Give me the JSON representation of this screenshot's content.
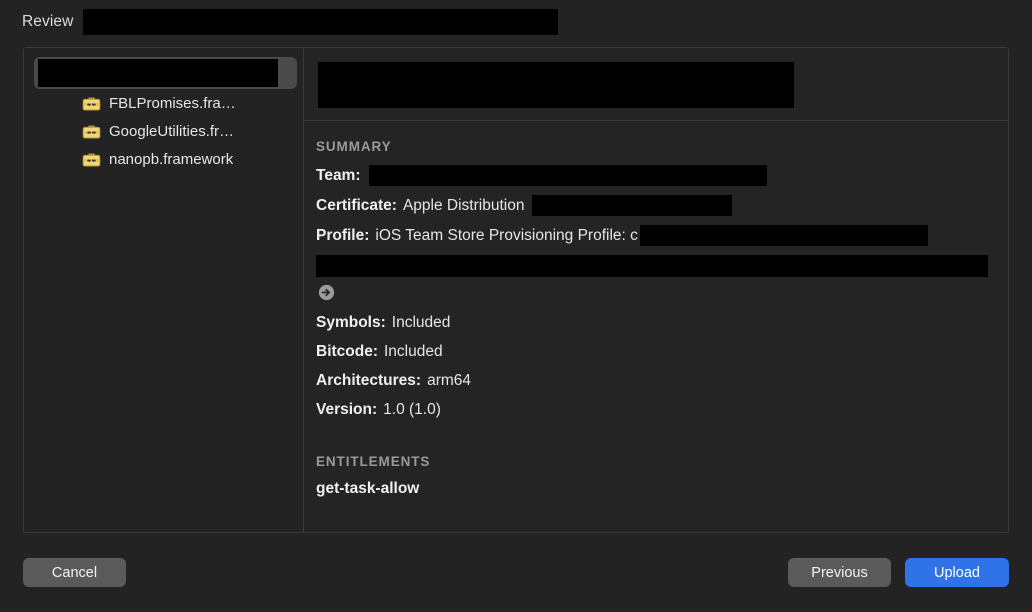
{
  "header": {
    "label": "Review",
    "redacted": true
  },
  "sidebar": {
    "root": {
      "name": "app-bundle-root",
      "redacted": true
    },
    "items": [
      {
        "icon": "framework-toolbox-icon",
        "label": "FBLPromises.fra…"
      },
      {
        "icon": "framework-toolbox-icon",
        "label": "GoogleUtilities.fr…"
      },
      {
        "icon": "framework-toolbox-icon",
        "label": "nanopb.framework"
      }
    ]
  },
  "detail": {
    "header_redacted": true,
    "summary": {
      "title": "SUMMARY",
      "rows": [
        {
          "key": "Team:",
          "value": "",
          "redacted": true
        },
        {
          "key": "Certificate:",
          "value": "Apple Distribution",
          "redacted": true
        },
        {
          "key": "Profile:",
          "value": "iOS Team Store Provisioning Profile: c",
          "redacted": true
        },
        {
          "key": "Symbols:",
          "value": "Included",
          "redacted": false
        },
        {
          "key": "Bitcode:",
          "value": "Included",
          "redacted": false
        },
        {
          "key": "Architectures:",
          "value": "arm64",
          "redacted": false
        },
        {
          "key": "Version:",
          "value": "1.0 (1.0)",
          "redacted": false
        }
      ],
      "go_icon": "arrow-right-circle-icon"
    },
    "entitlements": {
      "title": "ENTITLEMENTS",
      "items": [
        "get-task-allow"
      ]
    }
  },
  "footer": {
    "cancel_label": "Cancel",
    "previous_label": "Previous",
    "upload_label": "Upload"
  },
  "colors": {
    "window_background": "#232323",
    "panel_background": "#242424",
    "panel_border": "#3b3b3b",
    "redaction": "#000000",
    "selection": "#4a4a4a",
    "accent_blue": "#3073e8",
    "button_gray": "#5a5a5a",
    "section_title": "#9a9a9a",
    "framework_icon": "#e8c968",
    "text_primary": "#e8e8e8"
  }
}
